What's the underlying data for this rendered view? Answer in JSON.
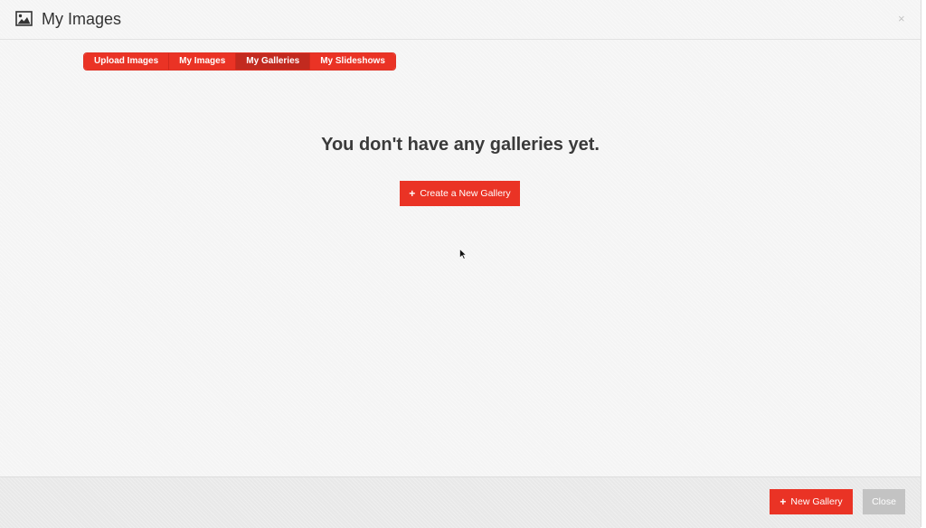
{
  "header": {
    "title": "My Images",
    "icon": "image-icon",
    "close_label": "×"
  },
  "tabs": [
    {
      "label": "Upload Images",
      "active": false
    },
    {
      "label": "My Images",
      "active": false
    },
    {
      "label": "My Galleries",
      "active": true
    },
    {
      "label": "My Slideshows",
      "active": false
    }
  ],
  "main": {
    "empty_message": "You don't have any galleries yet.",
    "create_button_label": "Create a New Gallery",
    "create_button_icon": "plus-icon"
  },
  "footer": {
    "new_gallery_label": "New Gallery",
    "new_gallery_icon": "plus-icon",
    "close_label": "Close"
  },
  "colors": {
    "accent": "#ea3325",
    "accent_active": "#c22a1f",
    "close_button": "#c3c3c3",
    "title_text": "#333333"
  }
}
